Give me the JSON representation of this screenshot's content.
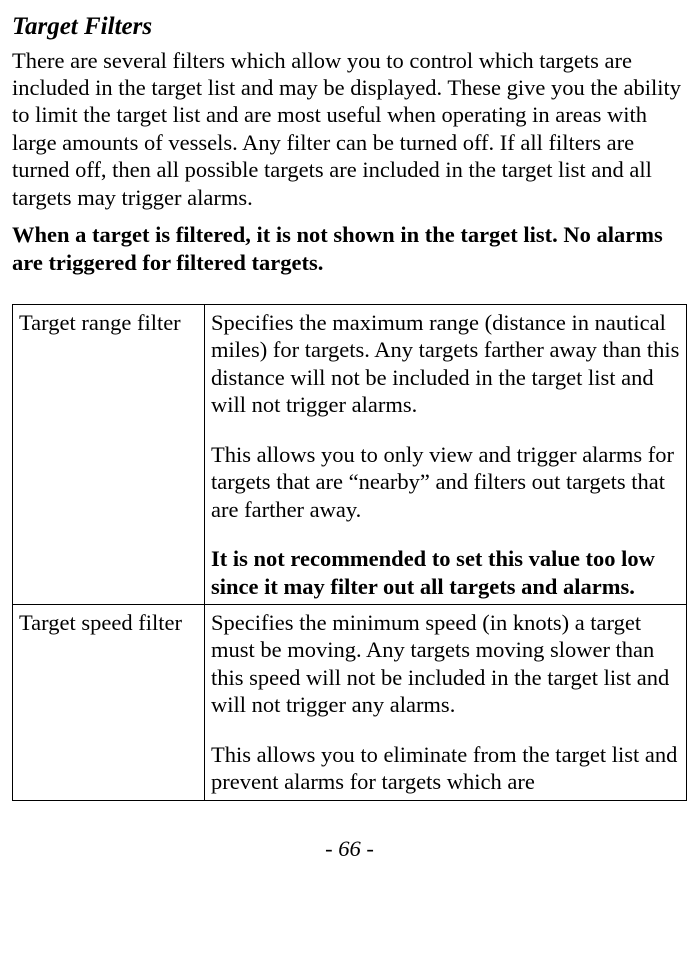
{
  "heading": "Target Filters",
  "intro": "There are several filters which allow you to control which targets are included in the target list and may be displayed. These give you the ability to limit the target list and are most useful when operating in areas with large amounts of vessels. Any filter can be turned off. If all filters are turned off, then all possible targets are included in the target list and all targets may trigger alarms.",
  "emphasis": "When a target is filtered, it is not shown in the target list. No alarms are triggered for filtered targets.",
  "rows": [
    {
      "name": "Target range filter",
      "p1": "Specifies the maximum range (distance in nautical miles) for targets. Any targets farther away than this distance will not be included in the target list and will not trigger alarms.",
      "p2": "This allows you to only view and trigger alarms for targets that are “nearby” and filters out targets that are farther away.",
      "p3": "It is not recommended to set this value too low since it may filter out all targets and alarms."
    },
    {
      "name": "Target speed filter",
      "p1": "Specifies the minimum speed (in knots) a target must be moving. Any targets moving slower than this speed will not be included in the target list and will not trigger any alarms.",
      "p2": "This allows you to eliminate from the target list and prevent alarms for targets which are"
    }
  ],
  "page_number": "- 66 -"
}
